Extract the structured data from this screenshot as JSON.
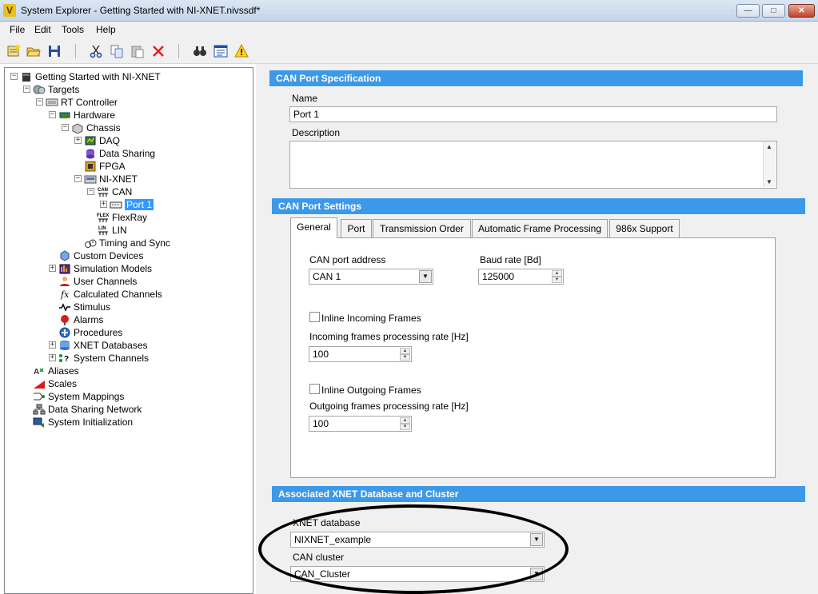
{
  "window": {
    "title": "System Explorer - Getting Started with NI-XNET.nivssdf*",
    "minimize": "—",
    "maximize": "□",
    "close": "✕"
  },
  "menu": [
    "File",
    "Edit",
    "Tools",
    "Help"
  ],
  "toolbar": {
    "icons": [
      "new-icon",
      "open-icon",
      "save-icon",
      "cut-icon",
      "copy-icon",
      "paste-icon",
      "delete-icon",
      "find-icon",
      "properties-icon",
      "warning-icon"
    ]
  },
  "tree": [
    {
      "label": "Getting Started with NI-XNET",
      "icon": "project-icon",
      "expander": "⊟"
    },
    {
      "label": "Targets",
      "icon": "targets-icon",
      "expander": "⊟"
    },
    {
      "label": "RT Controller",
      "icon": "controller-icon",
      "expander": "⊟"
    },
    {
      "label": "Hardware",
      "icon": "hardware-icon",
      "expander": "⊟"
    },
    {
      "label": "Chassis",
      "icon": "chassis-icon",
      "expander": "⊟"
    },
    {
      "label": "DAQ",
      "icon": "daq-icon",
      "expander": "⊞"
    },
    {
      "label": "Data Sharing",
      "icon": "data-sharing-icon",
      "expander": ""
    },
    {
      "label": "FPGA",
      "icon": "fpga-icon",
      "expander": ""
    },
    {
      "label": "NI-XNET",
      "icon": "xnet-icon",
      "expander": "⊟"
    },
    {
      "label": "CAN",
      "icon": "can-icon",
      "expander": "⊟"
    },
    {
      "label": "Port 1",
      "icon": "port-icon",
      "expander": "⊞"
    },
    {
      "label": "FlexRay",
      "icon": "flexray-icon",
      "expander": ""
    },
    {
      "label": "LIN",
      "icon": "lin-icon",
      "expander": ""
    },
    {
      "label": "Timing and Sync",
      "icon": "timing-icon",
      "expander": ""
    },
    {
      "label": "Custom Devices",
      "icon": "custom-devices-icon",
      "expander": ""
    },
    {
      "label": "Simulation Models",
      "icon": "simulation-models-icon",
      "expander": "⊞"
    },
    {
      "label": "User Channels",
      "icon": "user-channels-icon",
      "expander": ""
    },
    {
      "label": "Calculated Channels",
      "icon": "calculated-channels-icon",
      "expander": ""
    },
    {
      "label": "Stimulus",
      "icon": "stimulus-icon",
      "expander": ""
    },
    {
      "label": "Alarms",
      "icon": "alarms-icon",
      "expander": ""
    },
    {
      "label": "Procedures",
      "icon": "procedures-icon",
      "expander": ""
    },
    {
      "label": "XNET Databases",
      "icon": "xnet-databases-icon",
      "expander": "⊞"
    },
    {
      "label": "System Channels",
      "icon": "system-channels-icon",
      "expander": "⊞"
    },
    {
      "label": "Aliases",
      "icon": "aliases-icon",
      "expander": ""
    },
    {
      "label": "Scales",
      "icon": "scales-icon",
      "expander": ""
    },
    {
      "label": "System Mappings",
      "icon": "system-mappings-icon",
      "expander": ""
    },
    {
      "label": "Data Sharing Network",
      "icon": "data-sharing-network-icon",
      "expander": ""
    },
    {
      "label": "System Initialization",
      "icon": "system-initialization-icon",
      "expander": ""
    }
  ],
  "spec": {
    "header": "CAN Port Specification",
    "name_label": "Name",
    "name_value": "Port 1",
    "description_label": "Description",
    "description_value": ""
  },
  "settings": {
    "header": "CAN Port Settings",
    "tabs": [
      "General",
      "Port",
      "Transmission Order",
      "Automatic Frame Processing",
      "986x Support"
    ],
    "port_address_label": "CAN port address",
    "port_address_value": "CAN 1",
    "baud_label": "Baud rate [Bd]",
    "baud_value": "125000",
    "inline_incoming_label": "Inline Incoming Frames",
    "inline_incoming_checked": false,
    "incoming_rate_label": "Incoming frames processing rate [Hz]",
    "incoming_rate_value": "100",
    "inline_outgoing_label": "Inline Outgoing Frames",
    "inline_outgoing_checked": false,
    "outgoing_rate_label": "Outgoing frames processing rate [Hz]",
    "outgoing_rate_value": "100"
  },
  "assoc": {
    "header": "Associated XNET Database and Cluster",
    "db_label": "XNET database",
    "db_value": "NIXNET_example",
    "cluster_label": "CAN cluster",
    "cluster_value": "CAN_Cluster"
  },
  "colors": {
    "section_header": "#3c98e8",
    "selection": "#3399ff"
  }
}
